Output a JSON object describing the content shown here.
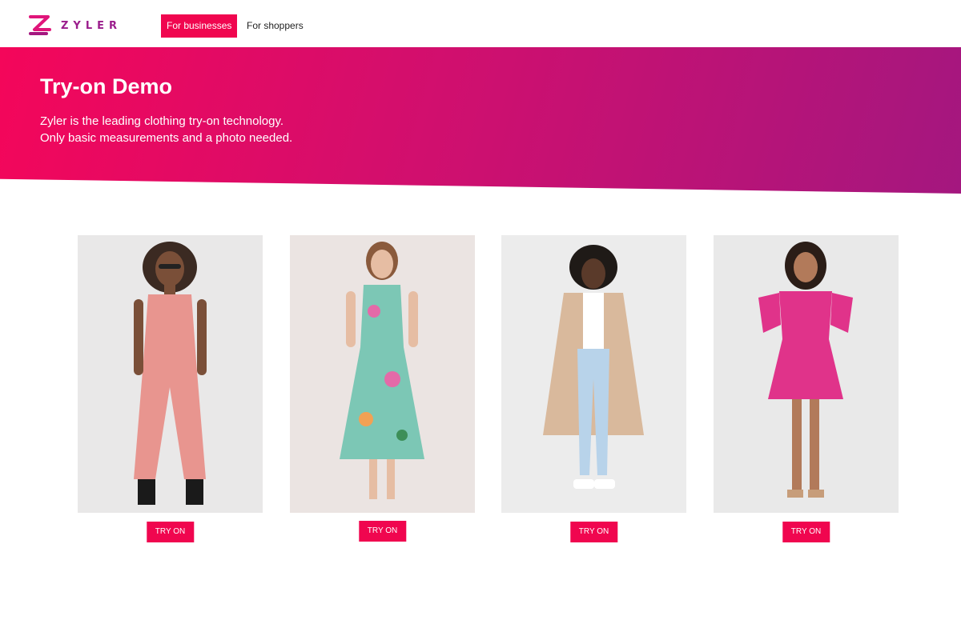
{
  "brand": {
    "name": "ZYLER",
    "logo_icon": "zyler-z-logo",
    "accent": "#f0064f",
    "logo_color": "#9b1d8c"
  },
  "nav": {
    "businesses_label": "For businesses",
    "shoppers_label": "For shoppers"
  },
  "hero": {
    "title": "Try-on Demo",
    "line1": "Zyler is the leading clothing try-on technology.",
    "line2": "Only basic measurements and a photo needed.",
    "gradient_start": "#f4065a",
    "gradient_end": "#a4177f"
  },
  "products": [
    {
      "outfit": "pink pinstripe waistcoat and trousers",
      "button_label": "TRY ON",
      "bg": "#e9e8e8",
      "color": "#e8958f"
    },
    {
      "outfit": "green floral midi dress",
      "button_label": "TRY ON",
      "bg": "#ebe4e2",
      "color": "#7cc7b5"
    },
    {
      "outfit": "beige trench coat with light jeans",
      "button_label": "TRY ON",
      "bg": "#ececec",
      "color": "#d9b99c"
    },
    {
      "outfit": "pink satin wrap dress",
      "button_label": "TRY ON",
      "bg": "#e9e9e9",
      "color": "#e0338a"
    }
  ]
}
